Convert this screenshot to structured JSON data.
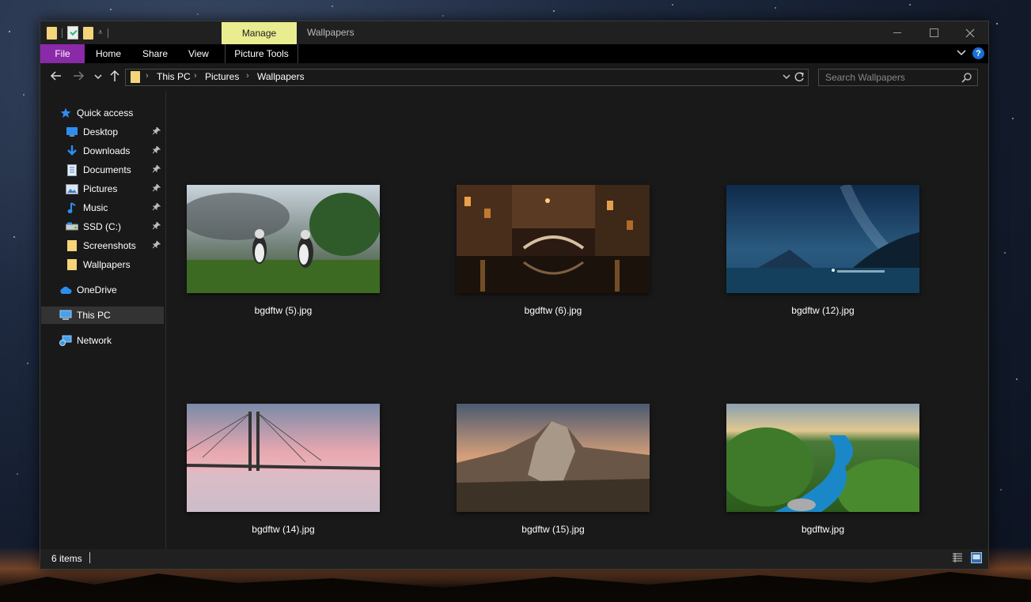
{
  "window": {
    "title": "Wallpapers",
    "contextual_tab": "Manage"
  },
  "ribbon": {
    "tabs": [
      "File",
      "Home",
      "Share",
      "View",
      "Picture Tools"
    ],
    "help_label": "?"
  },
  "address": {
    "crumbs": [
      "This PC",
      "Pictures",
      "Wallpapers"
    ],
    "search_placeholder": "Search Wallpapers"
  },
  "sidebar": {
    "items": [
      {
        "label": "Quick access",
        "icon": "star-icon"
      },
      {
        "label": "Desktop",
        "icon": "desktop-icon",
        "pinned": true
      },
      {
        "label": "Downloads",
        "icon": "download-icon",
        "pinned": true
      },
      {
        "label": "Documents",
        "icon": "document-icon",
        "pinned": true
      },
      {
        "label": "Pictures",
        "icon": "pictures-icon",
        "pinned": true
      },
      {
        "label": "Music",
        "icon": "music-icon",
        "pinned": true
      },
      {
        "label": "SSD (C:)",
        "icon": "drive-icon",
        "pinned": true
      },
      {
        "label": "Screenshots",
        "icon": "folder-icon",
        "pinned": true
      },
      {
        "label": "Wallpapers",
        "icon": "folder-icon"
      },
      {
        "label": "OneDrive",
        "icon": "cloud-icon"
      },
      {
        "label": "This PC",
        "icon": "computer-icon",
        "selected": true
      },
      {
        "label": "Network",
        "icon": "network-icon"
      }
    ]
  },
  "files": [
    {
      "name": "bgdftw (5).jpg"
    },
    {
      "name": "bgdftw (6).jpg"
    },
    {
      "name": "bgdftw (12).jpg"
    },
    {
      "name": "bgdftw (14).jpg"
    },
    {
      "name": "bgdftw (15).jpg"
    },
    {
      "name": "bgdftw.jpg"
    }
  ],
  "status": {
    "item_count": "6 items"
  },
  "colors": {
    "file_tab": "#8a2aa8",
    "manage_tab": "#e9ec8f",
    "help": "#1a6fd6",
    "folder": "#f4d57a"
  }
}
